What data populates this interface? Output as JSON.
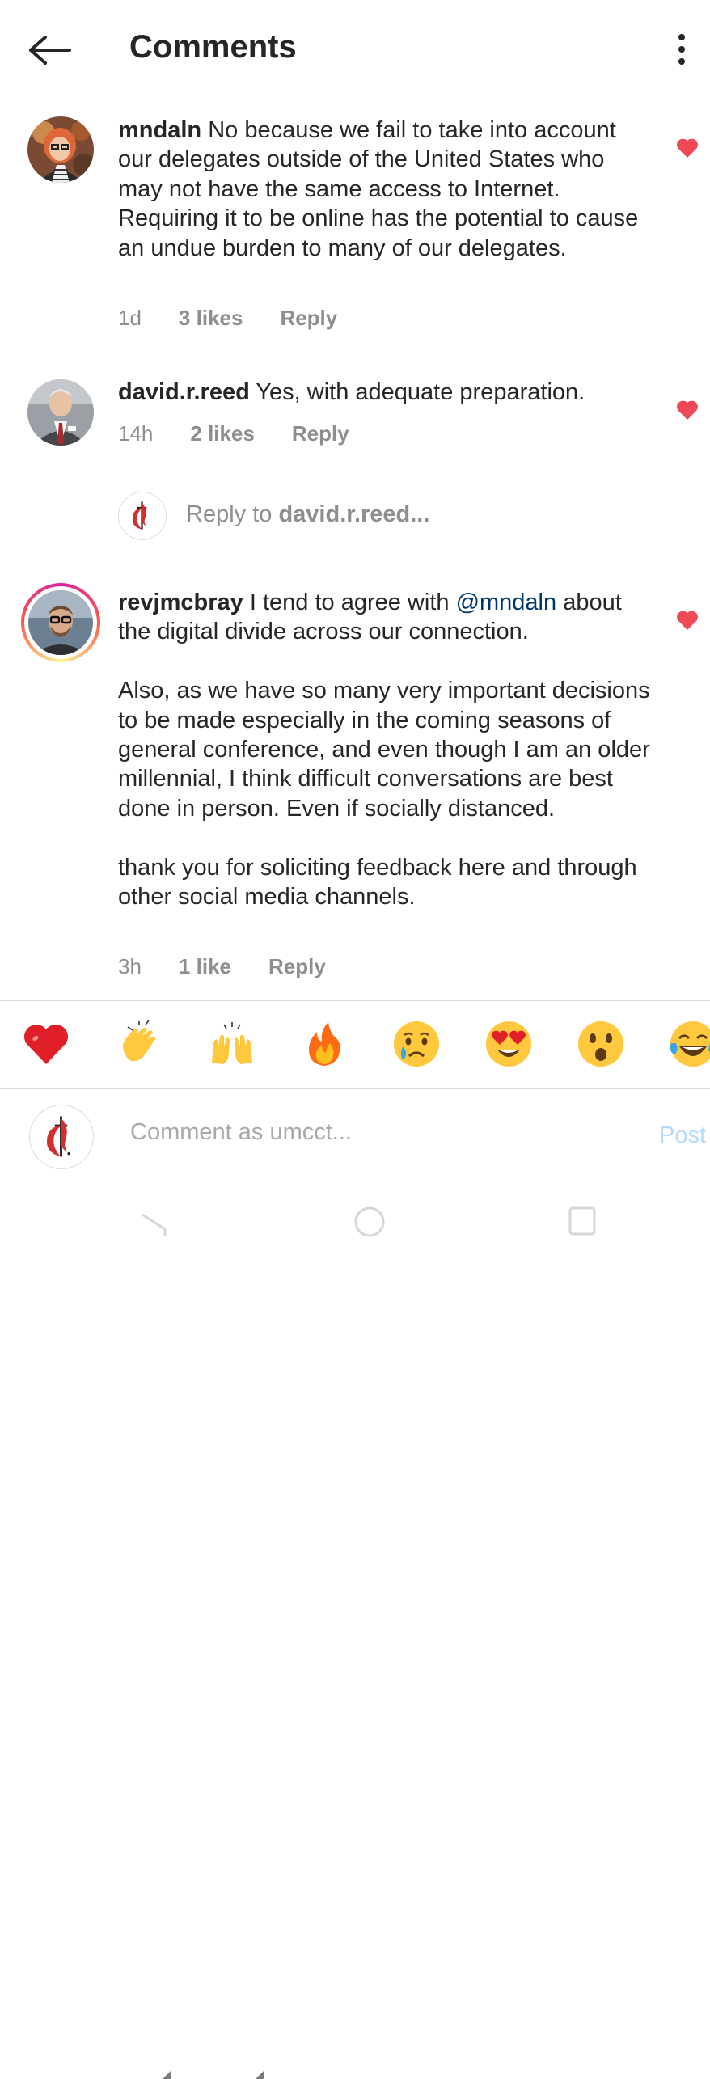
{
  "header": {
    "title": "Comments",
    "back_icon": "arrow-left-icon",
    "more_icon": "more-vertical-icon"
  },
  "comments": [
    {
      "username": "mndaln",
      "text": "No because we fail to take into account our delegates outside of the United States who may not have the same access to Internet. Requiring it to be online has the potential to cause an undue burden to many of our delegates.",
      "time": "1d",
      "likes": "3 likes",
      "reply": "Reply",
      "liked": true
    },
    {
      "username": "david.r.reed",
      "text": "Yes, with adequate preparation.",
      "time": "14h",
      "likes": "2 likes",
      "reply": "Reply",
      "liked": true
    },
    {
      "username": "revjmcbray",
      "text_before_mention": "I tend to agree with",
      "mention": "@mndaln",
      "text_after_mention": "about the digital divide across our connection.",
      "paragraph2": "Also, as we have so many very important decisions to be made especially in the coming seasons of general conference, and even though I am an older millennial, I think difficult conversations are best done in person. Even if socially distanced.",
      "paragraph3": "thank you for soliciting feedback here and through other social media channels.",
      "time": "3h",
      "likes": "1 like",
      "reply": "Reply",
      "liked": true
    }
  ],
  "reply_prompt": {
    "prefix": "Reply to",
    "target": "david.r.reed..."
  },
  "emoji_bar": [
    "❤️",
    "👏",
    "🙌",
    "🔥",
    "😢",
    "😍",
    "😮",
    "😂"
  ],
  "compose": {
    "placeholder": "Comment as umcct...",
    "post_label": "Post"
  },
  "colors": {
    "heart": "#ed4956",
    "mention": "#00376b",
    "post_disabled": "#b3dbff",
    "meta_grey": "#8e8e8e"
  },
  "navbar": {
    "back_icon": "nav-back-icon",
    "home_icon": "nav-home-icon",
    "recents_icon": "nav-recents-icon"
  }
}
